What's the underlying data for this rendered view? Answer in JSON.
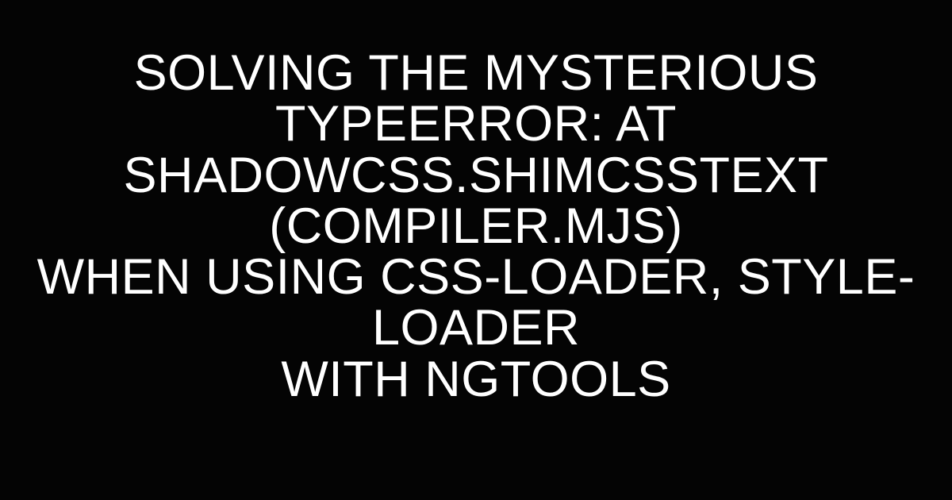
{
  "title": {
    "line1": "Solving the Mysterious TypeError: at",
    "line2": "ShadowCss.shimCssText (compiler.mjs)",
    "line3": "when using css-loader, style-loader",
    "line4": "with ngtools"
  }
}
